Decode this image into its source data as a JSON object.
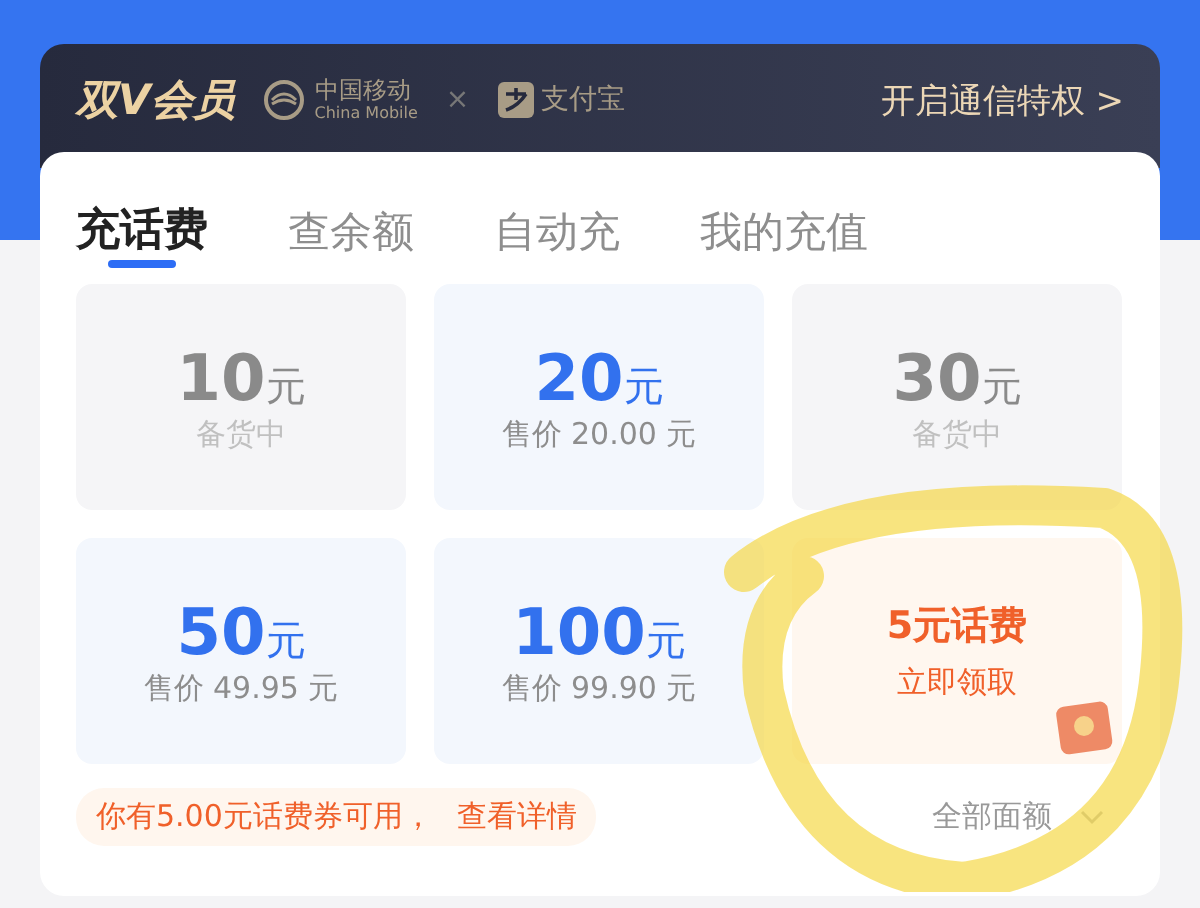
{
  "header": {
    "title": "双V会员",
    "partner_1": {
      "name": "中国移动",
      "sub": "China Mobile"
    },
    "separator": "×",
    "partner_2": {
      "name": "支付宝"
    },
    "link": "开启通信特权 >"
  },
  "tabs": [
    {
      "label": "充话费",
      "selected": true
    },
    {
      "label": "查余额",
      "selected": false
    },
    {
      "label": "自动充",
      "selected": false
    },
    {
      "label": "我的充值",
      "selected": false
    }
  ],
  "tiles": [
    {
      "kind": "stock",
      "amount": "10",
      "unit": "元",
      "note": "备货中"
    },
    {
      "kind": "sale",
      "amount": "20",
      "unit": "元",
      "note": "售价 20.00 元"
    },
    {
      "kind": "stock",
      "amount": "30",
      "unit": "元",
      "note": "备货中"
    },
    {
      "kind": "sale",
      "amount": "50",
      "unit": "元",
      "note": "售价 49.95 元"
    },
    {
      "kind": "sale",
      "amount": "100",
      "unit": "元",
      "note": "售价 99.90 元"
    },
    {
      "kind": "promo",
      "amount": "5元话费",
      "note": "立即领取"
    }
  ],
  "coupon": {
    "text": "你有5.00元话费券可用，",
    "link": "查看详情"
  },
  "all_amounts": "全部面额"
}
